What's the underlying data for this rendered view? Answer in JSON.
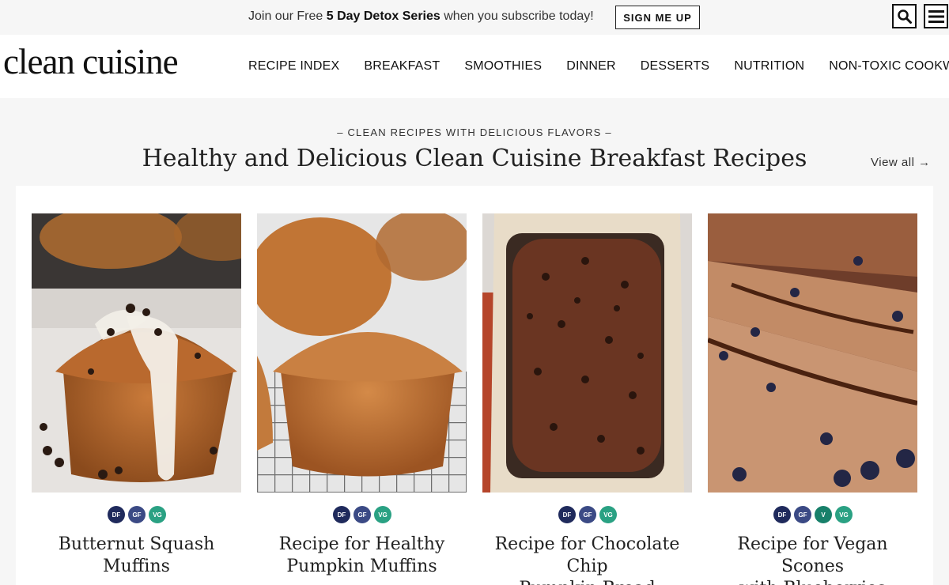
{
  "promo": {
    "text_before": "Join our Free ",
    "text_bold": "5 Day Detox Series",
    "text_after": " when you subscribe today!",
    "button_label": "SIGN ME UP"
  },
  "header": {
    "logo": "clean cuisine",
    "nav": [
      "RECIPE INDEX",
      "BREAKFAST",
      "SMOOTHIES",
      "DINNER",
      "DESSERTS",
      "NUTRITION",
      "NON-TOXIC COOKWARE"
    ]
  },
  "section": {
    "eyebrow": "– CLEAN RECIPES WITH DELICIOUS FLAVORS –",
    "title": "Healthy and Delicious Clean Cuisine Breakfast Recipes",
    "view_all": "View all →"
  },
  "icons": {
    "search": "search-icon",
    "menu": "hamburger-menu-icon"
  },
  "badge_colors": {
    "DF": "#1f2a5c",
    "GF": "#3b4a85",
    "V": "#18806a",
    "VG": "#2aa183"
  },
  "cards": [
    {
      "title_line1": "Butternut Squash",
      "title_line2": "Muffins",
      "badges": [
        "DF",
        "GF",
        "VG"
      ]
    },
    {
      "title_line1": "Recipe for Healthy",
      "title_line2": "Pumpkin Muffins",
      "badges": [
        "DF",
        "GF",
        "VG"
      ]
    },
    {
      "title_line1": "Recipe for Chocolate Chip",
      "title_line2": "Pumpkin Bread",
      "badges": [
        "DF",
        "GF",
        "VG"
      ]
    },
    {
      "title_line1": "Recipe for Vegan Scones",
      "title_line2": "with Blueberries",
      "badges": [
        "DF",
        "GF",
        "V",
        "VG"
      ]
    }
  ]
}
